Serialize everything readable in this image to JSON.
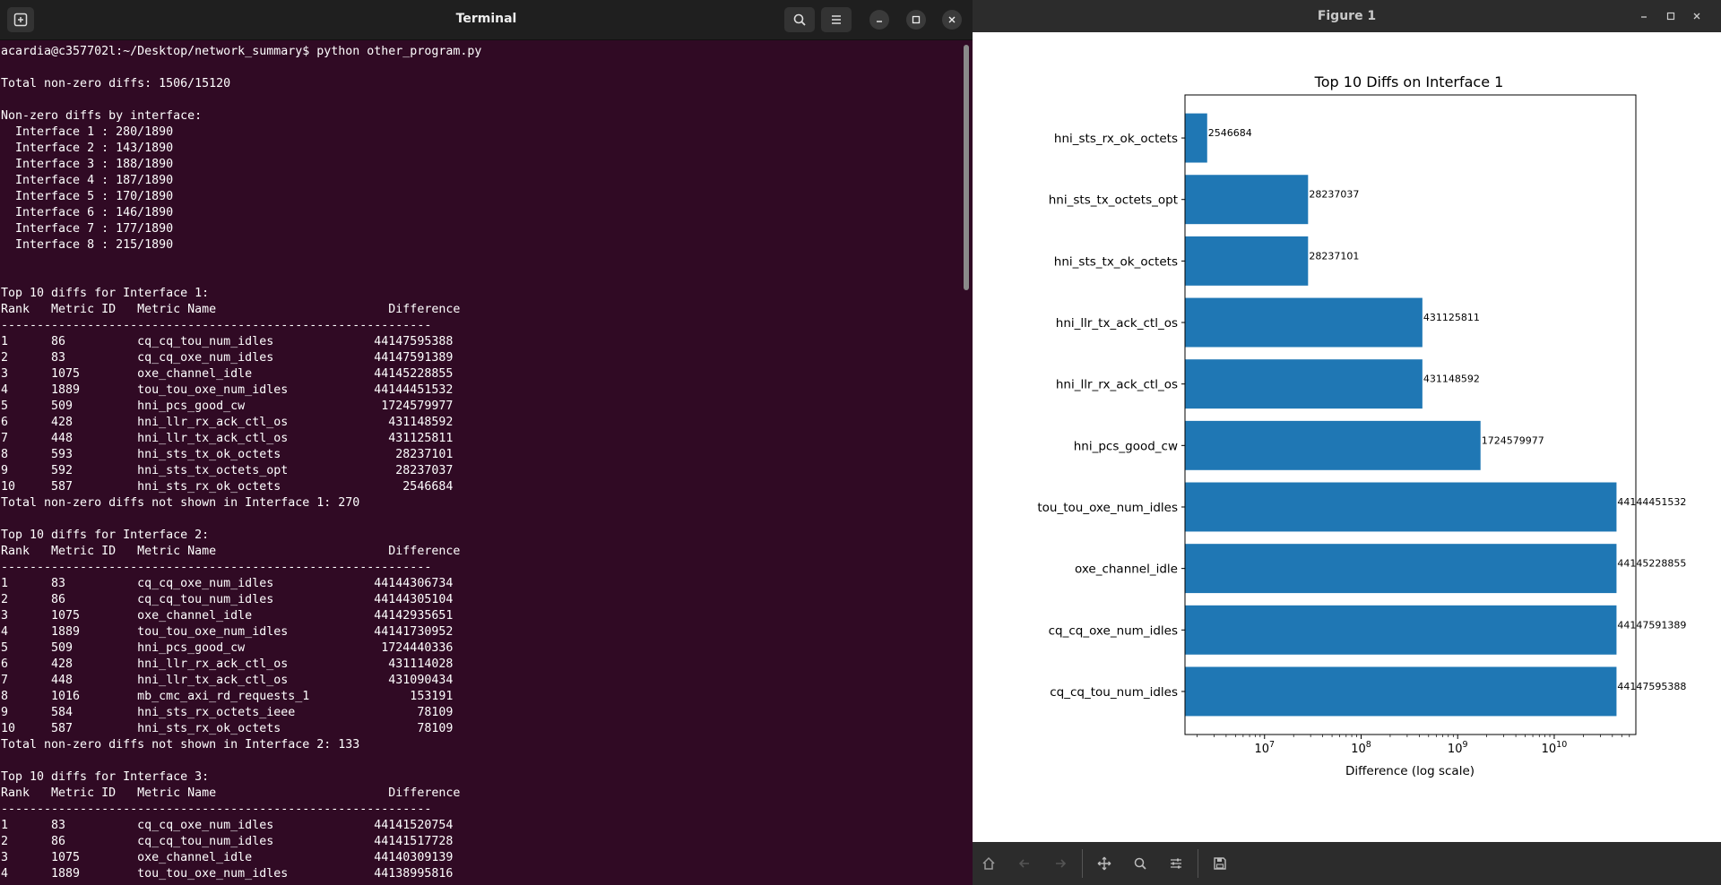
{
  "terminal": {
    "title": "Terminal",
    "lines": [
      "acardia@c357702l:~/Desktop/network_summary$ python other_program.py",
      "",
      "Total non-zero diffs: 1506/15120",
      "",
      "Non-zero diffs by interface:",
      "  Interface 1 : 280/1890",
      "  Interface 2 : 143/1890",
      "  Interface 3 : 188/1890",
      "  Interface 4 : 187/1890",
      "  Interface 5 : 170/1890",
      "  Interface 6 : 146/1890",
      "  Interface 7 : 177/1890",
      "  Interface 8 : 215/1890",
      "",
      "",
      "Top 10 diffs for Interface 1:",
      "Rank   Metric ID   Metric Name                        Difference",
      "------------------------------------------------------------",
      "1      86          cq_cq_tou_num_idles              44147595388",
      "2      83          cq_cq_oxe_num_idles              44147591389",
      "3      1075        oxe_channel_idle                 44145228855",
      "4      1889        tou_tou_oxe_num_idles            44144451532",
      "5      509         hni_pcs_good_cw                   1724579977",
      "6      428         hni_llr_rx_ack_ctl_os              431148592",
      "7      448         hni_llr_tx_ack_ctl_os              431125811",
      "8      593         hni_sts_tx_ok_octets                28237101",
      "9      592         hni_sts_tx_octets_opt               28237037",
      "10     587         hni_sts_rx_ok_octets                 2546684",
      "Total non-zero diffs not shown in Interface 1: 270",
      "",
      "Top 10 diffs for Interface 2:",
      "Rank   Metric ID   Metric Name                        Difference",
      "------------------------------------------------------------",
      "1      83          cq_cq_oxe_num_idles              44144306734",
      "2      86          cq_cq_tou_num_idles              44144305104",
      "3      1075        oxe_channel_idle                 44142935651",
      "4      1889        tou_tou_oxe_num_idles            44141730952",
      "5      509         hni_pcs_good_cw                   1724440336",
      "6      428         hni_llr_rx_ack_ctl_os              431114028",
      "7      448         hni_llr_tx_ack_ctl_os              431090434",
      "8      1016        mb_cmc_axi_rd_requests_1              153191",
      "9      584         hni_sts_rx_octets_ieee                 78109",
      "10     587         hni_sts_rx_ok_octets                   78109",
      "Total non-zero diffs not shown in Interface 2: 133",
      "",
      "Top 10 diffs for Interface 3:",
      "Rank   Metric ID   Metric Name                        Difference",
      "------------------------------------------------------------",
      "1      83          cq_cq_oxe_num_idles              44141520754",
      "2      86          cq_cq_tou_num_idles              44141517728",
      "3      1075        oxe_channel_idle                 44140309139",
      "4      1889        tou_tou_oxe_num_idles            44138995816"
    ]
  },
  "figure": {
    "title": "Figure 1"
  },
  "colors": {
    "terminal_bg": "#300a24",
    "bar": "#1f77b4"
  },
  "chart_data": {
    "type": "bar",
    "orientation": "horizontal",
    "title": "Top 10 Diffs on Interface 1",
    "xlabel": "Difference (log scale)",
    "ylabel": "",
    "xscale": "log",
    "xlim": [
      1500000,
      70000000000
    ],
    "x_ticks": [
      {
        "value": 10000000,
        "base": "10",
        "exp": "7"
      },
      {
        "value": 100000000,
        "base": "10",
        "exp": "8"
      },
      {
        "value": 1000000000,
        "base": "10",
        "exp": "9"
      },
      {
        "value": 10000000000,
        "base": "10",
        "exp": "10"
      }
    ],
    "categories": [
      "hni_sts_rx_ok_octets",
      "hni_sts_tx_octets_opt",
      "hni_sts_tx_ok_octets",
      "hni_llr_tx_ack_ctl_os",
      "hni_llr_rx_ack_ctl_os",
      "hni_pcs_good_cw",
      "tou_tou_oxe_num_idles",
      "oxe_channel_idle",
      "cq_cq_oxe_num_idles",
      "cq_cq_tou_num_idles"
    ],
    "values": [
      2546684,
      28237037,
      28237101,
      431125811,
      431148592,
      1724579977,
      44144451532,
      44145228855,
      44147591389,
      44147595388
    ],
    "value_labels": [
      "2546684",
      "28237037",
      "28237101",
      "431125811",
      "431148592",
      "1724579977",
      "44144451532",
      "44145228855",
      "44147591389",
      "44147595388"
    ],
    "grid": false,
    "legend": "none"
  }
}
